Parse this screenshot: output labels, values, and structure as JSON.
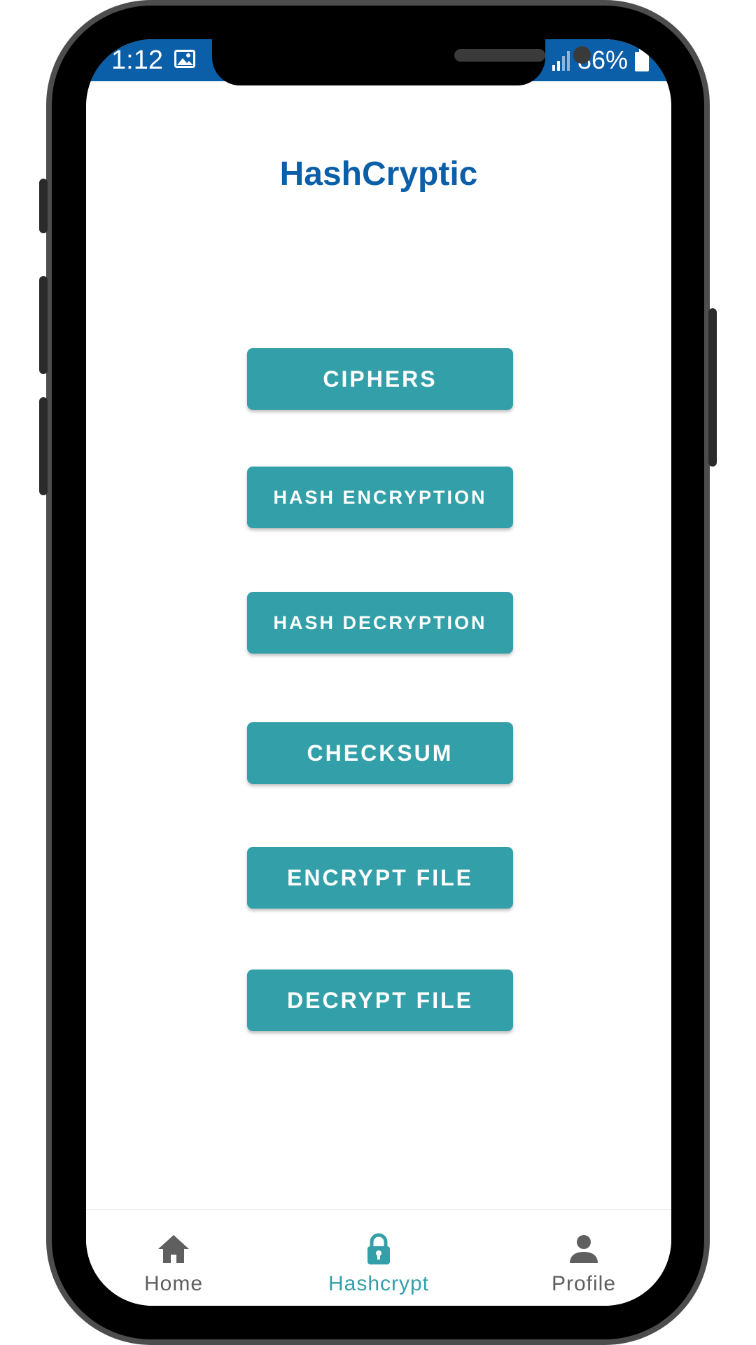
{
  "status_bar": {
    "time": "1:12",
    "battery": "86%",
    "icons": [
      "image-icon",
      "signal-icon",
      "battery-icon"
    ]
  },
  "header": {
    "title": "HashCryptic"
  },
  "menu": {
    "ciphers": "CIPHERS",
    "hash_encryption": "HASH ENCRYPTION",
    "hash_decryption": "HASH DECRYPTION",
    "checksum": "CHECKSUM",
    "encrypt_file": "ENCRYPT FILE",
    "decrypt_file": "DECRYPT FILE"
  },
  "bottom_nav": {
    "items": [
      {
        "label": "Home",
        "icon": "home-icon",
        "active": false
      },
      {
        "label": "Hashcrypt",
        "icon": "lock-icon",
        "active": true
      },
      {
        "label": "Profile",
        "icon": "person-icon",
        "active": false
      }
    ]
  },
  "colors": {
    "brand_blue": "#0b5ea8",
    "button_teal": "#339fa8",
    "nav_active": "#339fa8",
    "nav_inactive": "#5f5f5f"
  }
}
